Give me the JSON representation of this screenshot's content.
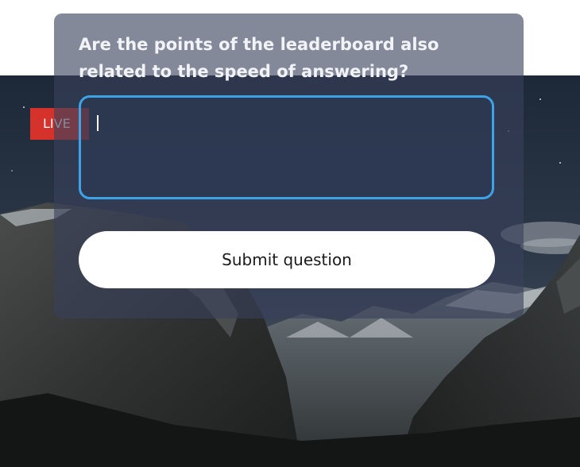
{
  "live_badge": {
    "label": "LIVE"
  },
  "question_card": {
    "question_text": "Are the points of the leaderboard also related to the speed of answering?",
    "answer_input": {
      "value": "",
      "placeholder": ""
    },
    "submit_label": "Submit question"
  },
  "colors": {
    "live_badge": "#d6322c",
    "input_border": "#3ea3e6",
    "card_overlay": "#38405a",
    "button_bg": "#ffffff"
  }
}
